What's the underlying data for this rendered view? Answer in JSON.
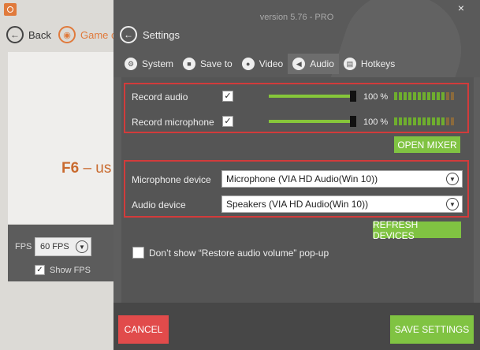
{
  "background_app": {
    "back_label": "Back",
    "game_label": "Game c",
    "hotkey_key": "F6",
    "hotkey_rest": " – us",
    "fps_label": "FPS",
    "fps_value": "60 FPS",
    "show_fps_label": "Show FPS",
    "show_fps_checked": true
  },
  "settings": {
    "version": "version 5.76 - PRO",
    "close_glyph": "×",
    "title": "Settings",
    "tabs": [
      {
        "label": "System",
        "icon": "gear-icon",
        "active": false
      },
      {
        "label": "Save to",
        "icon": "folder-icon",
        "active": false
      },
      {
        "label": "Video",
        "icon": "record-icon",
        "active": false
      },
      {
        "label": "Audio",
        "icon": "speaker-icon",
        "active": true
      },
      {
        "label": "Hotkeys",
        "icon": "hotkeys-icon",
        "active": false
      }
    ],
    "audio": {
      "record_audio": {
        "label": "Record audio",
        "checked": true,
        "volume_percent": 100,
        "volume_text": "100 %"
      },
      "record_microphone": {
        "label": "Record microphone",
        "checked": true,
        "volume_percent": 100,
        "volume_text": "100 %"
      },
      "open_mixer_label": "OPEN MIXER",
      "microphone_device": {
        "label": "Microphone device",
        "value": "Microphone (VIA HD Audio(Win 10))"
      },
      "audio_device": {
        "label": "Audio device",
        "value": "Speakers (VIA HD Audio(Win 10))"
      },
      "refresh_devices_label": "REFRESH DEVICES",
      "restore_popup": {
        "label": "Don’t show “Restore audio volume” pop-up",
        "checked": false
      }
    },
    "cancel_label": "CANCEL",
    "save_label": "SAVE SETTINGS"
  },
  "colors": {
    "accent_green": "#80c342",
    "highlight_red": "#d23b3b",
    "cancel_red": "#e14b4b",
    "brand_orange": "#e07a3c"
  }
}
